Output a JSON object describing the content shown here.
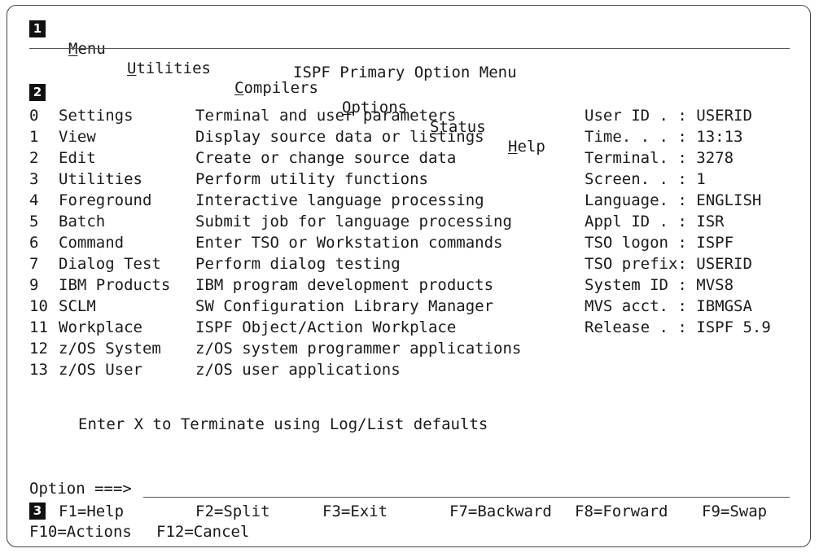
{
  "markers": {
    "m1": "1",
    "m2": "2",
    "m3": "3"
  },
  "menubar": {
    "items": [
      {
        "label_u": "M",
        "label_rest": "enu"
      },
      {
        "label_u": "U",
        "label_rest": "tilities"
      },
      {
        "label_u": "C",
        "label_rest": "ompilers"
      },
      {
        "label_u": "O",
        "label_rest": "ptions"
      },
      {
        "label_u": "S",
        "label_rest": "tatus"
      },
      {
        "label_u": "H",
        "label_rest": "elp"
      }
    ]
  },
  "panel": {
    "title": "ISPF Primary Option Menu"
  },
  "options": [
    {
      "num": "0",
      "name": "Settings",
      "desc": "Terminal and user parameters"
    },
    {
      "num": "1",
      "name": "View",
      "desc": "Display source data or listings"
    },
    {
      "num": "2",
      "name": "Edit",
      "desc": "Create or change source data"
    },
    {
      "num": "3",
      "name": "Utilities",
      "desc": "Perform utility functions"
    },
    {
      "num": "4",
      "name": "Foreground",
      "desc": "Interactive language processing"
    },
    {
      "num": "5",
      "name": "Batch",
      "desc": "Submit job for language processing"
    },
    {
      "num": "6",
      "name": "Command",
      "desc": "Enter TSO or Workstation commands"
    },
    {
      "num": "7",
      "name": "Dialog Test",
      "desc": "Perform dialog testing"
    },
    {
      "num": "9",
      "name": "IBM Products",
      "desc": "IBM program development products"
    },
    {
      "num": "10",
      "name": "SCLM",
      "desc": "SW Configuration Library Manager"
    },
    {
      "num": "11",
      "name": "Workplace",
      "desc": "ISPF Object/Action Workplace"
    },
    {
      "num": "12",
      "name": "z/OS System",
      "desc": "z/OS system programmer applications"
    },
    {
      "num": "13",
      "name": "z/OS User",
      "desc": "z/OS user applications"
    }
  ],
  "session_info": [
    "User ID . : USERID",
    "Time. . . : 13:13",
    "Terminal. : 3278",
    "Screen. . : 1",
    "Language. : ENGLISH",
    "Appl ID . : ISR",
    "TSO logon : ISPF",
    "TSO prefix: USERID",
    "System ID : MVS8",
    "MVS acct. : IBMGSA",
    "Release . : ISPF 5.9"
  ],
  "terminate_hint": "Enter X to Terminate using Log/List defaults",
  "command": {
    "label": "Option ===>",
    "value": ""
  },
  "fkeys_row1": [
    "F1=Help",
    "F2=Split",
    "F3=Exit",
    "F7=Backward",
    "F8=Forward",
    "F9=Swap"
  ],
  "fkeys_row2": [
    "F10=Actions",
    "F12=Cancel"
  ]
}
